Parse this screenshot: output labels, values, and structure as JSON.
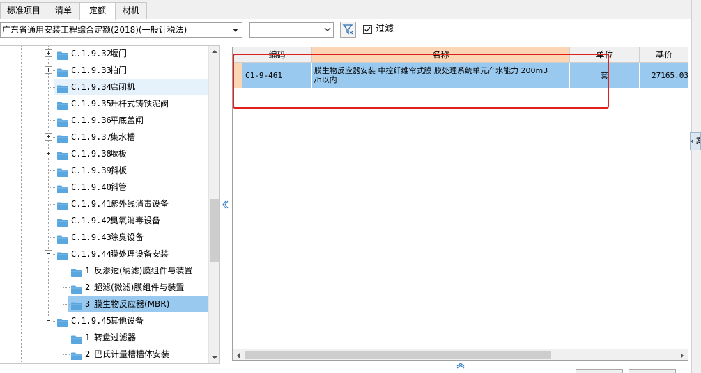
{
  "tabs": [
    {
      "label": "标准项目",
      "active": false
    },
    {
      "label": "清单",
      "active": false
    },
    {
      "label": "定额",
      "active": true
    },
    {
      "label": "材机",
      "active": false
    }
  ],
  "toolbar": {
    "library_value": "广东省通用安装工程综合定额(2018)(一般计税法)",
    "filter_value": "",
    "filter_checkbox_label": "过滤",
    "filter_checked": true
  },
  "tree": {
    "items": [
      {
        "code": "C.1.9.32",
        "label": "堰门"
      },
      {
        "code": "C.1.9.33",
        "label": "拍门"
      },
      {
        "code": "C.1.9.34",
        "label": "启闭机"
      },
      {
        "code": "C.1.9.35",
        "label": "升杆式铸铁泥阀"
      },
      {
        "code": "C.1.9.36",
        "label": "平底盖闸"
      },
      {
        "code": "C.1.9.37",
        "label": "集水槽"
      },
      {
        "code": "C.1.9.38",
        "label": "堰板"
      },
      {
        "code": "C.1.9.39",
        "label": "斜板"
      },
      {
        "code": "C.1.9.40",
        "label": "斜管"
      },
      {
        "code": "C.1.9.41",
        "label": "紫外线消毒设备"
      },
      {
        "code": "C.1.9.42",
        "label": "臭氧消毒设备"
      },
      {
        "code": "C.1.9.43",
        "label": "除臭设备"
      },
      {
        "code": "C.1.9.44",
        "label": "膜处理设备安装"
      },
      {
        "code": "1",
        "label": "反渗透(纳滤)膜组件与装置"
      },
      {
        "code": "2",
        "label": "超滤(微滤)膜组件与装置"
      },
      {
        "code": "3",
        "label": "膜生物反应器(MBR)"
      },
      {
        "code": "C.1.9.45",
        "label": "其他设备"
      },
      {
        "code": "1",
        "label": "转盘过滤器"
      },
      {
        "code": "2",
        "label": "巴氏计量槽槽体安装"
      }
    ]
  },
  "grid": {
    "columns": [
      {
        "label": "编码"
      },
      {
        "label": "名称"
      },
      {
        "label": "单位"
      },
      {
        "label": "基价"
      }
    ],
    "rows": [
      {
        "code": "C1-9-461",
        "name_line1": "膜生物反应器安装 中控纤维帘式膜 膜处理系统单元产水能力 200m3",
        "name_line2": "/h以内",
        "unit": "套",
        "price": "27165.03"
      }
    ]
  },
  "side_stub_text": "‹ 案",
  "colors": {
    "selection": "#99c9ef",
    "header_highlight": "#fcd5b4",
    "annotation_red": "#e0201c",
    "folder_blue": "#5aa7e0"
  }
}
